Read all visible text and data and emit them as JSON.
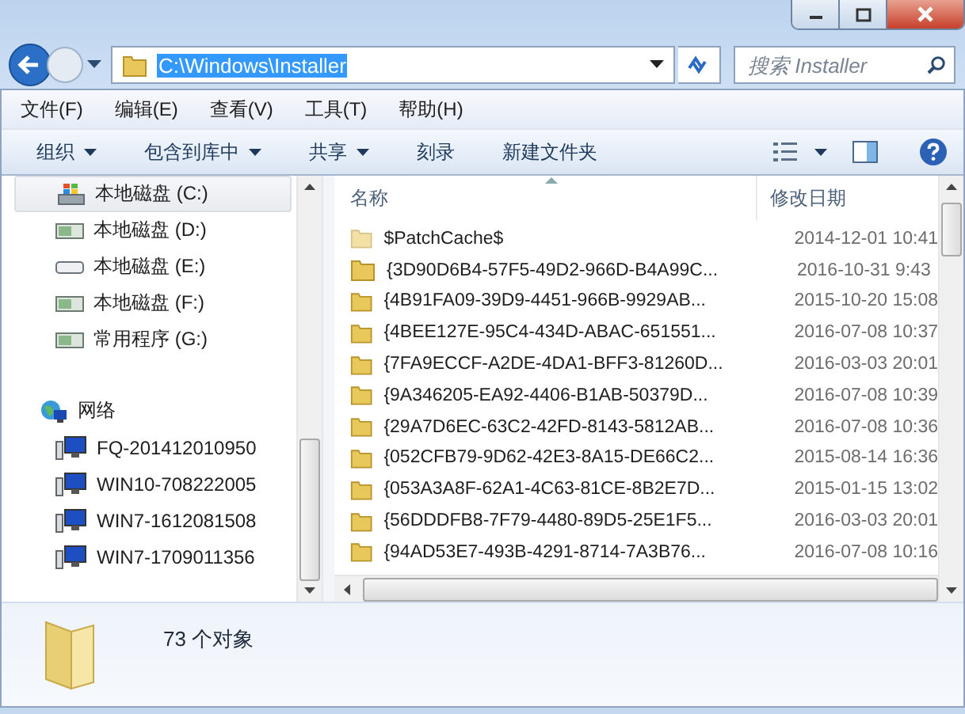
{
  "address": {
    "path": "C:\\Windows\\Installer"
  },
  "search": {
    "placeholder": "搜索 Installer"
  },
  "menu": [
    "文件(F)",
    "编辑(E)",
    "查看(V)",
    "工具(T)",
    "帮助(H)"
  ],
  "toolbar": [
    {
      "label": "组织",
      "has_menu": true
    },
    {
      "label": "包含到库中",
      "has_menu": true
    },
    {
      "label": "共享",
      "has_menu": true
    },
    {
      "label": "刻录",
      "has_menu": false
    },
    {
      "label": "新建文件夹",
      "has_menu": false
    }
  ],
  "sidebar": {
    "drives": [
      {
        "label": "本地磁盘 (C:)",
        "kind": "system",
        "selected": true
      },
      {
        "label": "本地磁盘 (D:)",
        "kind": "disk",
        "selected": false
      },
      {
        "label": "本地磁盘 (E:)",
        "kind": "removable",
        "selected": false
      },
      {
        "label": "本地磁盘 (F:)",
        "kind": "disk",
        "selected": false
      },
      {
        "label": "常用程序 (G:)",
        "kind": "disk",
        "selected": false
      }
    ],
    "network": {
      "label": "网络",
      "children": [
        {
          "label": "FQ-201412010950"
        },
        {
          "label": "WIN10-708222005"
        },
        {
          "label": "WIN7-1612081508"
        },
        {
          "label": "WIN7-1709011356"
        }
      ]
    }
  },
  "table": {
    "columns": [
      "名称",
      "修改日期"
    ],
    "rows": [
      {
        "name": "$PatchCache$",
        "date": "2014-12-01 10:41",
        "hidden": true
      },
      {
        "name": "{3D90D6B4-57F5-49D2-966D-B4A99C...",
        "date": "2016-10-31 9:43",
        "hidden": false
      },
      {
        "name": "{4B91FA09-39D9-4451-966B-9929AB...",
        "date": "2015-10-20 15:08",
        "hidden": false
      },
      {
        "name": "{4BEE127E-95C4-434D-ABAC-651551...",
        "date": "2016-07-08 10:37",
        "hidden": false
      },
      {
        "name": "{7FA9ECCF-A2DE-4DA1-BFF3-81260D...",
        "date": "2016-03-03 20:01",
        "hidden": false
      },
      {
        "name": "{9A346205-EA92-4406-B1AB-50379D...",
        "date": "2016-07-08 10:39",
        "hidden": false
      },
      {
        "name": "{29A7D6EC-63C2-42FD-8143-5812AB...",
        "date": "2016-07-08 10:36",
        "hidden": false
      },
      {
        "name": "{052CFB79-9D62-42E3-8A15-DE66C2...",
        "date": "2015-08-14 16:36",
        "hidden": false
      },
      {
        "name": "{053A3A8F-62A1-4C63-81CE-8B2E7D...",
        "date": "2015-01-15 13:02",
        "hidden": false
      },
      {
        "name": "{56DDDFB8-7F79-4480-89D5-25E1F5...",
        "date": "2016-03-03 20:01",
        "hidden": false
      },
      {
        "name": "{94AD53E7-493B-4291-8714-7A3B76...",
        "date": "2016-07-08 10:16",
        "hidden": false
      }
    ]
  },
  "status_bar": {
    "count": "73 个对象"
  }
}
